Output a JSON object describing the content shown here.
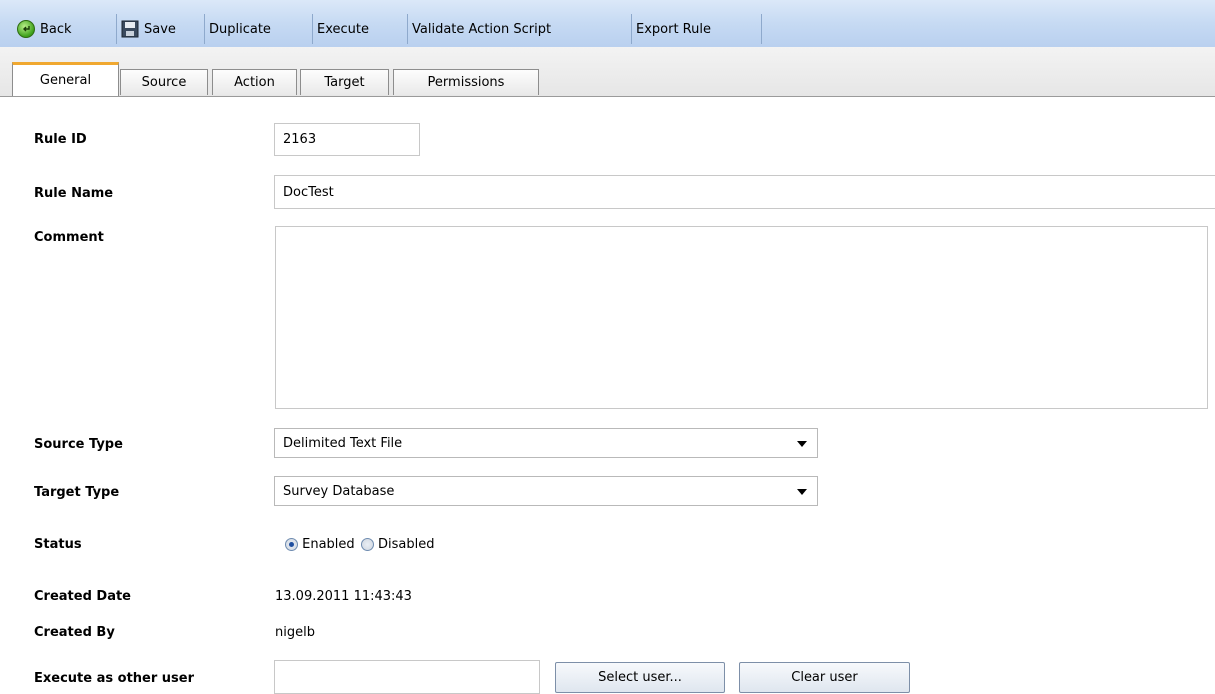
{
  "toolbar": {
    "back": "Back",
    "save": "Save",
    "duplicate": "Duplicate",
    "execute": "Execute",
    "validate": "Validate Action Script",
    "export": "Export Rule"
  },
  "tabs": [
    "General",
    "Source",
    "Action",
    "Target",
    "Permissions"
  ],
  "form": {
    "rule_id_label": "Rule ID",
    "rule_id_value": "2163",
    "rule_name_label": "Rule Name",
    "rule_name_value": "DocTest",
    "comment_label": "Comment",
    "comment_value": "",
    "source_type_label": "Source Type",
    "source_type_value": "Delimited Text File",
    "target_type_label": "Target Type",
    "target_type_value": "Survey Database",
    "status_label": "Status",
    "status_enabled": "Enabled",
    "status_disabled": "Disabled",
    "status_selected": "Enabled",
    "created_date_label": "Created Date",
    "created_date_value": "13.09.2011 11:43:43",
    "created_by_label": "Created By",
    "created_by_value": "nigelb",
    "execute_as_label": "Execute as other user",
    "execute_as_value": "",
    "select_user_button": "Select user...",
    "clear_user_button": "Clear user"
  },
  "colors": {
    "toolbar_bg": "#c6daf3",
    "active_tab_accent": "#f0a830"
  },
  "icons": {
    "back": "back-arrow-icon",
    "save": "floppy-disk-icon",
    "select_arrow": "chevron-down-icon"
  }
}
